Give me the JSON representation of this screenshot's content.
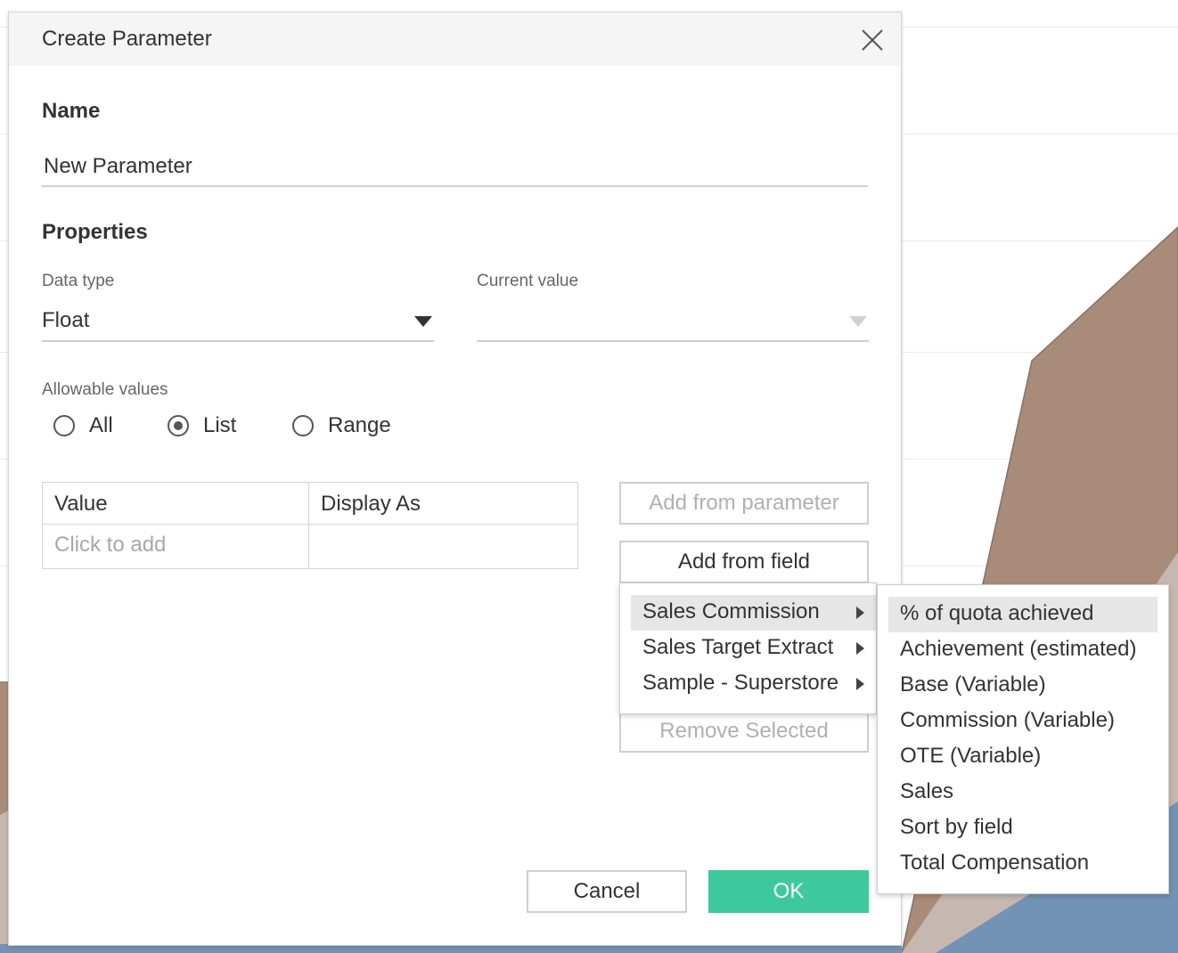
{
  "dialog": {
    "title": "Create Parameter",
    "close_icon": "close-icon"
  },
  "name_section": {
    "heading": "Name",
    "value": "New Parameter"
  },
  "properties": {
    "heading": "Properties",
    "data_type_label": "Data type",
    "data_type_value": "Float",
    "current_value_label": "Current value",
    "current_value": ""
  },
  "allowable_values": {
    "label": "Allowable values",
    "options": [
      {
        "label": "All",
        "selected": false
      },
      {
        "label": "List",
        "selected": true
      },
      {
        "label": "Range",
        "selected": false
      }
    ]
  },
  "values_table": {
    "headers": [
      "Value",
      "Display As"
    ],
    "placeholder": "Click to add"
  },
  "buttons": {
    "add_from_parameter": "Add from parameter",
    "add_from_field": "Add from field",
    "remove_selected": "Remove Selected",
    "cancel": "Cancel",
    "ok": "OK"
  },
  "datasource_menu": {
    "items": [
      "Sales Commission",
      "Sales Target Extract",
      "Sample - Superstore"
    ],
    "highlighted_index": 0
  },
  "field_menu": {
    "items": [
      "% of quota achieved",
      "Achievement (estimated)",
      "Base (Variable)",
      "Commission (Variable)",
      "OTE (Variable)",
      "Sales",
      "Sort by field",
      "Total Compensation"
    ],
    "highlighted_index": 0
  },
  "colors": {
    "ok_button": "#3dc99b",
    "background_area_brown": "#a98b7a",
    "background_area_gray": "#c6b8b0",
    "background_area_blue": "#7393b4"
  }
}
